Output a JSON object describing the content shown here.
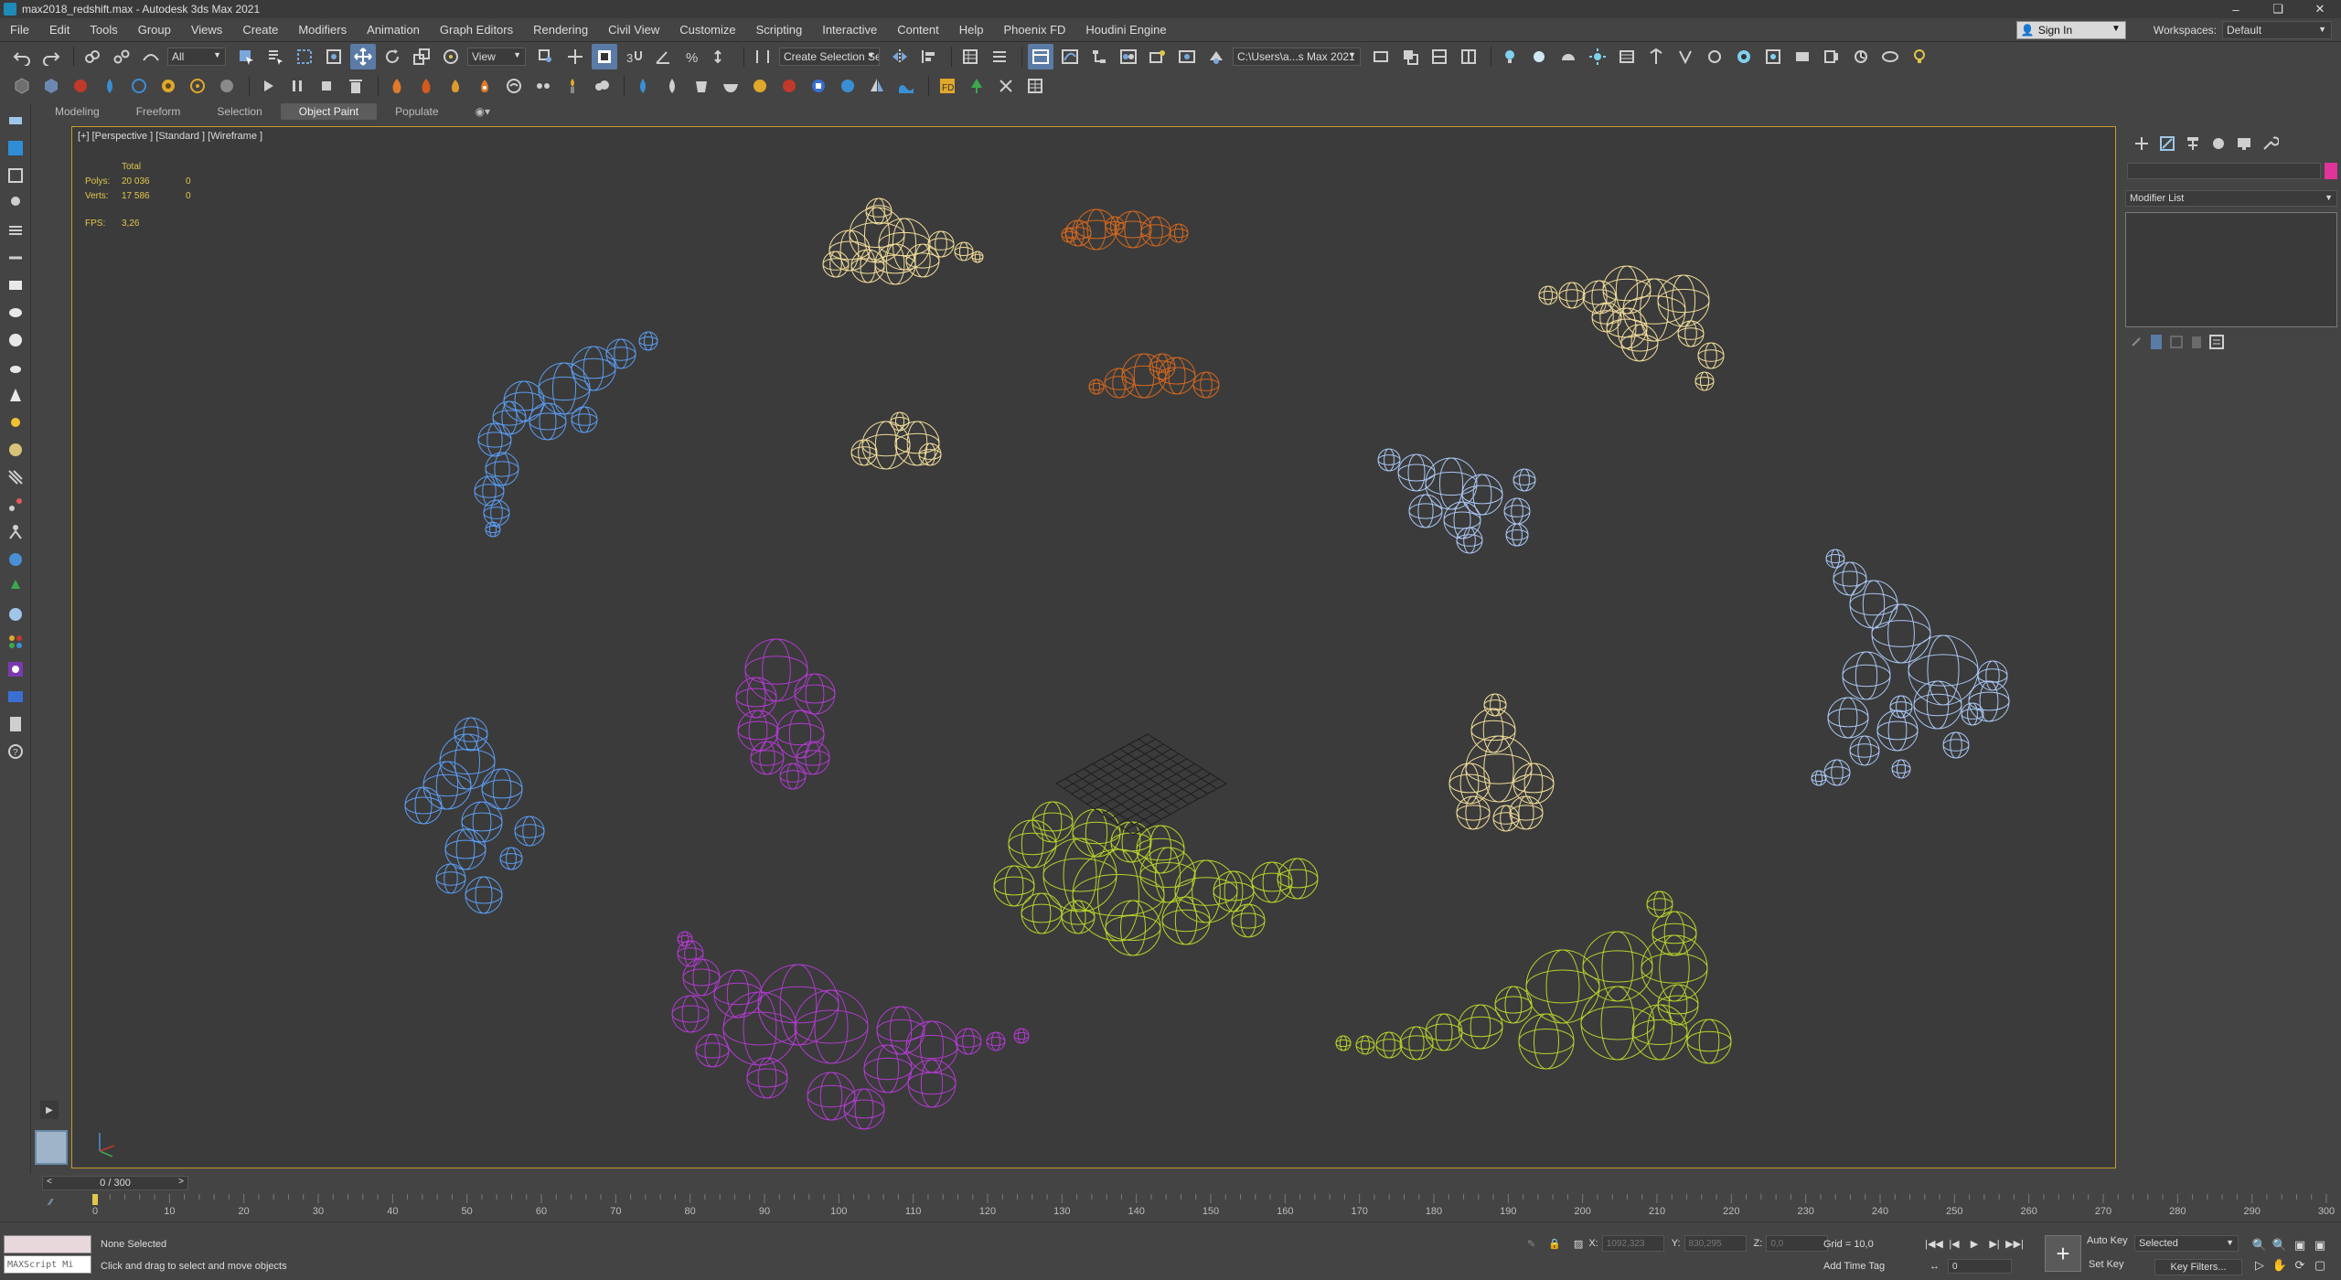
{
  "window": {
    "title": "max2018_redshift.max - Autodesk 3ds Max 2021"
  },
  "menu": [
    "File",
    "Edit",
    "Tools",
    "Group",
    "Views",
    "Create",
    "Modifiers",
    "Animation",
    "Graph Editors",
    "Rendering",
    "Civil View",
    "Customize",
    "Scripting",
    "Interactive",
    "Content",
    "Help",
    "Phoenix FD",
    "Houdini Engine"
  ],
  "account": {
    "sign_in": "Sign In",
    "workspaces_label": "Workspaces:",
    "workspace": "Default"
  },
  "toolbar": {
    "selection_filter": "All",
    "ref_coord": "View",
    "named_selection": "Create Selection Se",
    "project_path": "C:\\Users\\a...s Max 2021"
  },
  "ribbon": {
    "tabs": [
      "Modeling",
      "Freeform",
      "Selection",
      "Object Paint",
      "Populate"
    ],
    "active": "Object Paint"
  },
  "viewport": {
    "label": "[+] [Perspective ] [Standard ] [Wireframe ]",
    "stats": {
      "header": "Total",
      "polys_label": "Polys:",
      "polys_value": "20 036",
      "polys_sel": "0",
      "verts_label": "Verts:",
      "verts_value": "17 586",
      "verts_sel": "0",
      "fps_label": "FPS:",
      "fps_value": "3,26"
    },
    "colors": {
      "cream": "#f0dc9a",
      "blue": "#5b9cf0",
      "lightblue": "#a9c6f2",
      "orange": "#d2671e",
      "magenta": "#b13ad0",
      "lime": "#b6d22a",
      "border": "#c79a2b"
    }
  },
  "command_panel": {
    "modifier_list": "Modifier List"
  },
  "timeline": {
    "slider": "0 / 300",
    "ticks": [
      "0",
      "10",
      "20",
      "30",
      "40",
      "50",
      "60",
      "70",
      "80",
      "90",
      "100",
      "110",
      "120",
      "130",
      "140",
      "150",
      "160",
      "170",
      "180",
      "190",
      "200",
      "210",
      "220",
      "230",
      "240",
      "250",
      "260",
      "270",
      "280",
      "290",
      "300"
    ]
  },
  "status": {
    "selection": "None Selected",
    "prompt": "Click and drag to select and move objects",
    "maxscript": "MAXScript Mi",
    "x_label": "X:",
    "x_value": "1092,323",
    "y_label": "Y:",
    "y_value": "830,295",
    "z_label": "Z:",
    "z_value": "0,0",
    "grid": "Grid = 10,0",
    "add_time_tag": "Add Time Tag",
    "frame": "0",
    "auto_key": "Auto Key",
    "set_key": "Set Key",
    "selected": "Selected",
    "key_filters": "Key Filters..."
  }
}
